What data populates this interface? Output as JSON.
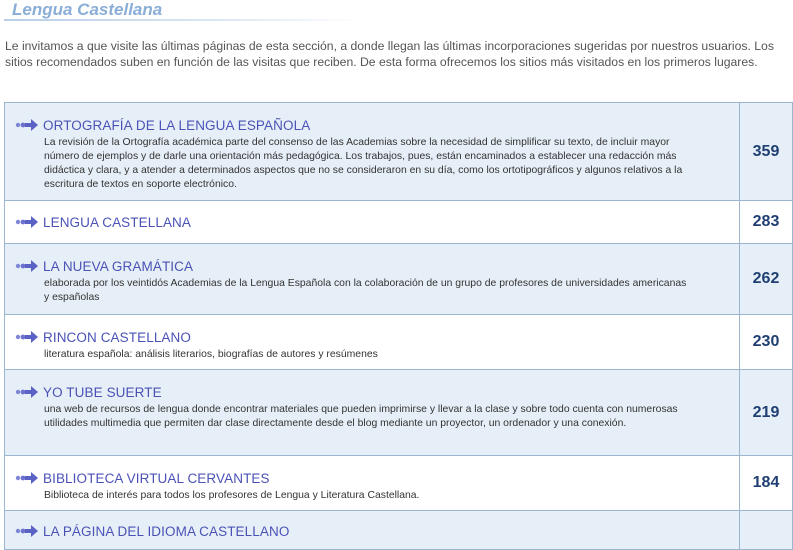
{
  "page": {
    "title": "Lengua Castellana",
    "intro": "Le invitamos a que visite las últimas páginas de esta sección, a donde llegan las últimas incorporaciones sugeridas por nuestros usuarios. Los sitios recomendados suben en función de las visitas que reciben. De esta forma ofrecemos los sitios más visitados en los primeros lugares."
  },
  "colors": {
    "title": "#8aaed6",
    "link": "#4a52b6",
    "count": "#1f3f73",
    "row_shaded": "#e6eff7",
    "border": "#9db6cf"
  },
  "sites": [
    {
      "title": "ORTOGRAFÍA DE LA LENGUA ESPAÑOLA",
      "description": "La revisión de la Ortografía académica parte del consenso de las Academias sobre la necesidad de simplificar su texto, de incluir mayor número de ejemplos y de darle una orientación más pedagógica. Los trabajos, pues, están encaminados a establecer una redacción más didáctica y clara, y a atender a determinados aspectos que no se consideraron en su día, como los ortotipográficos y algunos relativos a la escritura de textos en soporte electrónico.",
      "visits": "359"
    },
    {
      "title": "LENGUA CASTELLANA",
      "description": "",
      "visits": "283"
    },
    {
      "title": "LA NUEVA GRAMÁTICA",
      "description": "elaborada por los veintidós Academias de la Lengua Española con la colaboración de un grupo de profesores de universidades americanas y españolas",
      "visits": "262"
    },
    {
      "title": "RINCON CASTELLANO",
      "description": "literatura española: análisis literarios, biografías de autores y resúmenes",
      "visits": "230"
    },
    {
      "title": "YO TUBE SUERTE",
      "description": "una web de recursos de lengua donde encontrar materiales que pueden imprimirse y llevar a la clase y sobre todo cuenta con numerosas utilidades multimedia que permiten dar clase directamente desde el blog mediante un proyector, un ordenador y una conexión.",
      "visits": "219"
    },
    {
      "title": "BIBLIOTECA VIRTUAL CERVANTES",
      "description": "Biblioteca de interés para todos los profesores de Lengua y Literatura Castellana.",
      "visits": "184"
    },
    {
      "title": "LA PÁGINA DEL IDIOMA CASTELLANO",
      "description": "",
      "visits": ""
    }
  ],
  "icons": {
    "row_marker": "arrow-right-icon"
  }
}
